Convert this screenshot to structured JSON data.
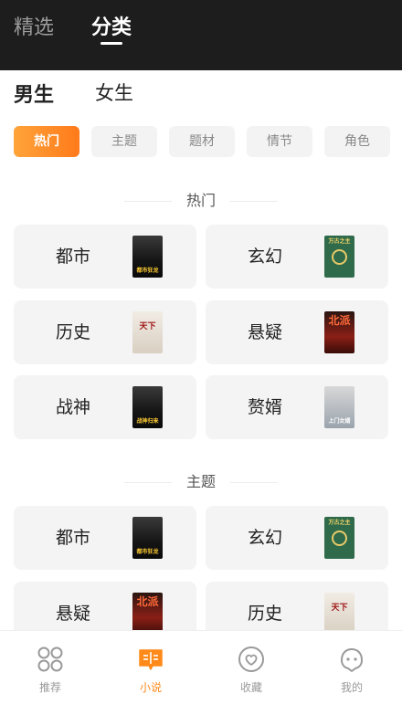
{
  "top_tabs": [
    {
      "label": "精选",
      "active": false
    },
    {
      "label": "分类",
      "active": true
    }
  ],
  "gender_tabs": [
    {
      "label": "男生",
      "active": true
    },
    {
      "label": "女生",
      "active": false
    }
  ],
  "filters": [
    {
      "label": "热门",
      "active": true
    },
    {
      "label": "主题",
      "active": false
    },
    {
      "label": "题材",
      "active": false
    },
    {
      "label": "情节",
      "active": false
    },
    {
      "label": "角色",
      "active": false
    }
  ],
  "sections": [
    {
      "title": "热门",
      "items": [
        {
          "label": "都市",
          "cover_text": "都市狂龙",
          "cover_style": "dark"
        },
        {
          "label": "玄幻",
          "cover_text": "万古之主",
          "cover_style": "green"
        },
        {
          "label": "历史",
          "cover_text": "天下",
          "cover_style": "light"
        },
        {
          "label": "悬疑",
          "cover_text": "北派",
          "cover_style": "red"
        },
        {
          "label": "战神",
          "cover_text": "战神归来",
          "cover_style": "dark"
        },
        {
          "label": "赘婿",
          "cover_text": "上门女婿",
          "cover_style": "gray"
        }
      ]
    },
    {
      "title": "主题",
      "items": [
        {
          "label": "都市",
          "cover_text": "都市狂龙",
          "cover_style": "dark"
        },
        {
          "label": "玄幻",
          "cover_text": "万古之主",
          "cover_style": "green"
        },
        {
          "label": "悬疑",
          "cover_text": "北派",
          "cover_style": "red"
        },
        {
          "label": "历史",
          "cover_text": "天下",
          "cover_style": "light"
        }
      ]
    }
  ],
  "bottom_nav": [
    {
      "label": "推荐",
      "icon": "grid-icon",
      "active": false
    },
    {
      "label": "小说",
      "icon": "book-icon",
      "active": true
    },
    {
      "label": "收藏",
      "icon": "heart-icon",
      "active": false
    },
    {
      "label": "我的",
      "icon": "profile-icon",
      "active": false
    }
  ],
  "colors": {
    "accent": "#ff8a1a",
    "topbar": "#1d1d1d"
  }
}
